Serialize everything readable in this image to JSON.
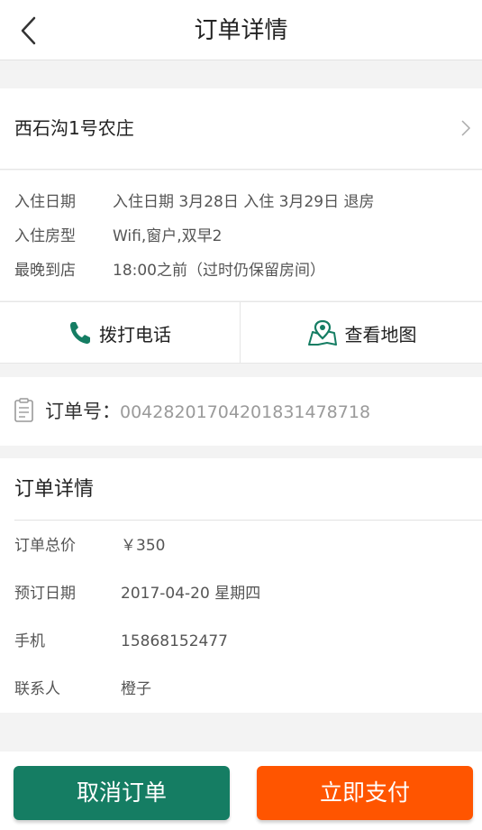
{
  "header": {
    "title": "订单详情"
  },
  "hotel": {
    "name": "西石沟1号农庄"
  },
  "info": [
    {
      "key": "入住日期",
      "value": "入住日期 3月28日 入住 3月29日 退房"
    },
    {
      "key": "入住房型",
      "value": "Wifi,窗户,双早2"
    },
    {
      "key": "最晚到店",
      "value": "18:00之前（过时仍保留房间）"
    }
  ],
  "actions": {
    "call_label": "拨打电话",
    "map_label": "查看地图"
  },
  "order": {
    "label": "订单号：",
    "number": "004282017042018314787 18"
  },
  "details": {
    "title": "订单详情",
    "rows": [
      {
        "key": "订单总价",
        "value": "￥350"
      },
      {
        "key": "预订日期",
        "value": "2017-04-20 星期四"
      },
      {
        "key": "手机",
        "value": "15868152477"
      },
      {
        "key": "联系人",
        "value": "橙子"
      }
    ]
  },
  "footer": {
    "cancel_label": "取消订单",
    "pay_label": "立即支付"
  },
  "colors": {
    "primary_green": "#157d63",
    "accent_orange": "#ff5500"
  },
  "icons": {
    "back": "back-arrow-icon",
    "chevron": "chevron-right-icon",
    "phone": "phone-icon",
    "map": "map-pin-icon",
    "order": "order-document-icon"
  }
}
